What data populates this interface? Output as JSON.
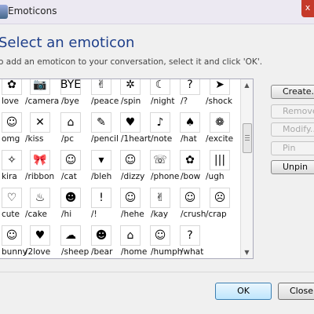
{
  "window": {
    "title": "Emoticons",
    "close_glyph": "x"
  },
  "header": {
    "heading": "Select an emoticon",
    "description": "o add an emoticon to your conversation, select it and click 'OK'."
  },
  "emoticon_rows": [
    {
      "labels": [
        "love",
        "/camera",
        "/bye",
        "/peace",
        "/spin",
        "/night",
        "/?",
        "/shock"
      ],
      "glyphs": [
        "✿",
        "📷",
        "BYE",
        "✌",
        "✲",
        "☾",
        "?",
        "➤"
      ]
    },
    {
      "labels": [
        "omg",
        "/kiss",
        "/pc",
        "/pencil",
        "/1heart",
        "/note",
        "/hat",
        "/excite"
      ],
      "glyphs": [
        "☺",
        "✕",
        "⌂",
        "✎",
        "♥",
        "♪",
        "♠",
        "❁"
      ]
    },
    {
      "labels": [
        "kira",
        "/ribbon",
        "/cat",
        "/bleh",
        "/dizzy",
        "/phone",
        "/bow",
        "/ugh"
      ],
      "glyphs": [
        "✧",
        "🎀",
        "☺",
        "▾",
        "☺",
        "☏",
        "✿",
        "|||"
      ]
    },
    {
      "labels": [
        "cute",
        "/cake",
        "/hi",
        "/!",
        "/hehe",
        "/kay",
        "/crush",
        "/crap"
      ],
      "glyphs": [
        "♡",
        "♨",
        "☻",
        "!",
        "☺",
        "✌",
        "☺",
        "☹"
      ]
    },
    {
      "labels": [
        "bunny",
        "/2love",
        "/sheep",
        "/bear",
        "/home",
        "/humph",
        "/what"
      ],
      "glyphs": [
        "☺",
        "♥",
        "☁",
        "☻",
        "⌂",
        "☺",
        "?"
      ]
    }
  ],
  "buttons": {
    "create": "Create...",
    "remove": "Remove",
    "modify": "Modify...",
    "pin": "Pin",
    "unpin": "Unpin"
  },
  "footer": {
    "ok": "OK",
    "close": "Close"
  }
}
